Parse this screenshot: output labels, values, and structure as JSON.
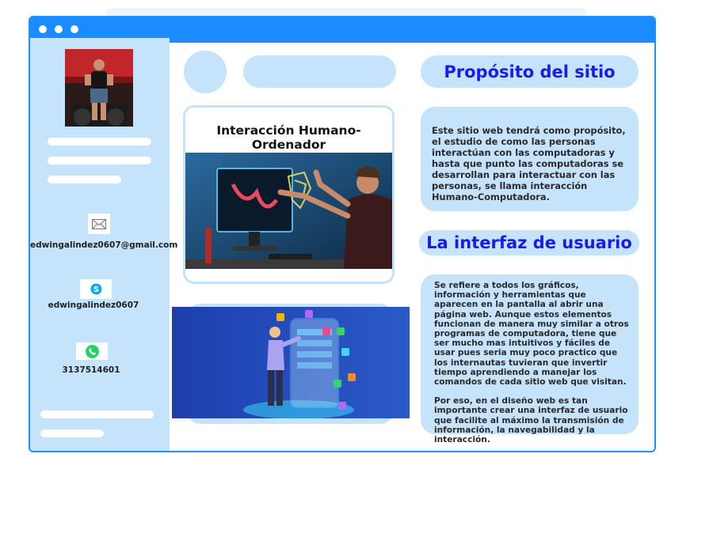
{
  "sidebar": {
    "email": "edwingalindez0607@gmail.com",
    "skype": "edwingalindez0607",
    "phone": "3137514601"
  },
  "main": {
    "card_title": "Interacción Humano-Ordenador"
  },
  "right": {
    "purpose_title": "Propósito del sitio",
    "purpose_text": "Este sitio web tendrá como propósito, el estudio de como las personas interactúan con las computadoras y hasta que punto las computadoras se desarrollan para interactuar con las personas, se llama interacción Humano-Computadora.",
    "ui_title": "La interfaz de usuario",
    "ui_text_1": "Se refiere a todos los gráficos, información y herramientas que aparecen en la pantalla al abrir una página web. Aunque estos elementos funcionan de manera muy similar a otros programas de computadora, tiene que ser mucho mas intuitivos y fáciles de usar pues seria muy poco practico que los internautas tuvieran que invertir tiempo aprendiendo a manejar los comandos de cada sitio web que visitan.",
    "ui_text_2": "Por eso, en el diseño web es tan importante crear una interfaz de usuario que facilite al máximo la transmisión de información, la navegabilidad y la interacción."
  },
  "icons": {
    "window_controls": [
      "dot",
      "dot",
      "dot"
    ],
    "email": "envelope-icon",
    "skype": "skype-icon",
    "phone": "whatsapp-icon"
  },
  "colors": {
    "accent": "#1a8cff",
    "panel": "#c5e3fb",
    "heading": "#1a1aee",
    "whatsapp": "#25d366",
    "skype": "#00aff0"
  }
}
